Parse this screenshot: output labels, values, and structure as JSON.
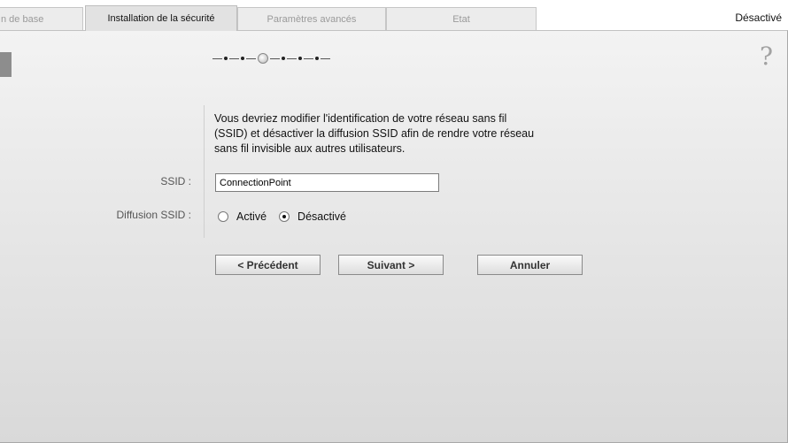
{
  "tabs": [
    {
      "label": "n de base",
      "active": false
    },
    {
      "label": "Installation de la sécurité",
      "active": true
    },
    {
      "label": "Paramètres avancés",
      "active": false
    },
    {
      "label": "Etat",
      "active": false
    }
  ],
  "status_text": "Désactivé",
  "help_icon": "?",
  "wizard": {
    "steps_total": 6,
    "current_step": 3
  },
  "description": {
    "line1": "Vous devriez modifier l'identification de votre réseau sans fil",
    "line2": "(SSID) et désactiver la diffusion SSID afin de rendre votre réseau",
    "line3": "sans fil invisible aux autres utilisateurs."
  },
  "form": {
    "ssid_label": "SSID :",
    "ssid_value": "ConnectionPoint",
    "broadcast_label": "Diffusion SSID :",
    "broadcast_options": [
      {
        "label": "Activé",
        "checked": false
      },
      {
        "label": "Désactivé",
        "checked": true
      }
    ]
  },
  "buttons": {
    "prev": "< Précédent",
    "next": "Suivant >",
    "cancel": "Annuler"
  },
  "colors": {
    "panel_top": "#f3f3f3",
    "panel_bottom": "#d9d9d9",
    "tab_active": "#e2e2e2",
    "tab_inactive": "#ececec"
  }
}
